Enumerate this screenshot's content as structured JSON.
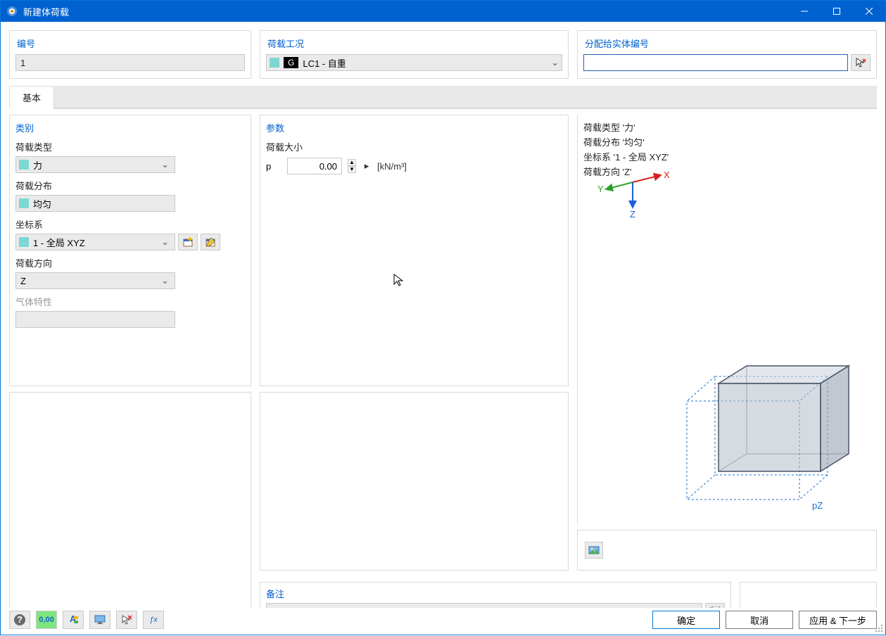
{
  "window": {
    "title": "新建体荷载"
  },
  "top": {
    "number_label": "编号",
    "number_value": "1",
    "loadcase_label": "荷载工况",
    "loadcase_badge": "G",
    "loadcase_text": "LC1 - 自重",
    "assign_label": "分配给实体编号",
    "assign_value": ""
  },
  "tabs": {
    "basic": "基本"
  },
  "category": {
    "title": "类别",
    "load_type_label": "荷载类型",
    "load_type_value": "力",
    "distribution_label": "荷载分布",
    "distribution_value": "均匀",
    "coord_label": "坐标系",
    "coord_value": "1 - 全局 XYZ",
    "direction_label": "荷载方向",
    "direction_value": "Z",
    "gas_label": "气体特性"
  },
  "params": {
    "title": "参数",
    "magnitude_label": "荷载大小",
    "symbol": "p",
    "value": "0.00",
    "unit": "[kN/m³]"
  },
  "preview": {
    "line1": "荷载类型 '力'",
    "line2": "荷载分布 '均匀'",
    "line3": "坐标系 '1 - 全局 XYZ'",
    "line4": "荷载方向 'Z'",
    "axis_x": "X",
    "axis_y": "Y",
    "axis_z": "Z",
    "cube_label": "pZ"
  },
  "notes": {
    "title": "备注",
    "value": ""
  },
  "toolbar": {
    "t1": "?",
    "t2": "0,00",
    "t3": "A",
    "t4": "⬒",
    "t5": "✕",
    "t6": "ƒx"
  },
  "buttons": {
    "ok": "确定",
    "cancel": "取消",
    "apply_next": "应用 & 下一步"
  }
}
